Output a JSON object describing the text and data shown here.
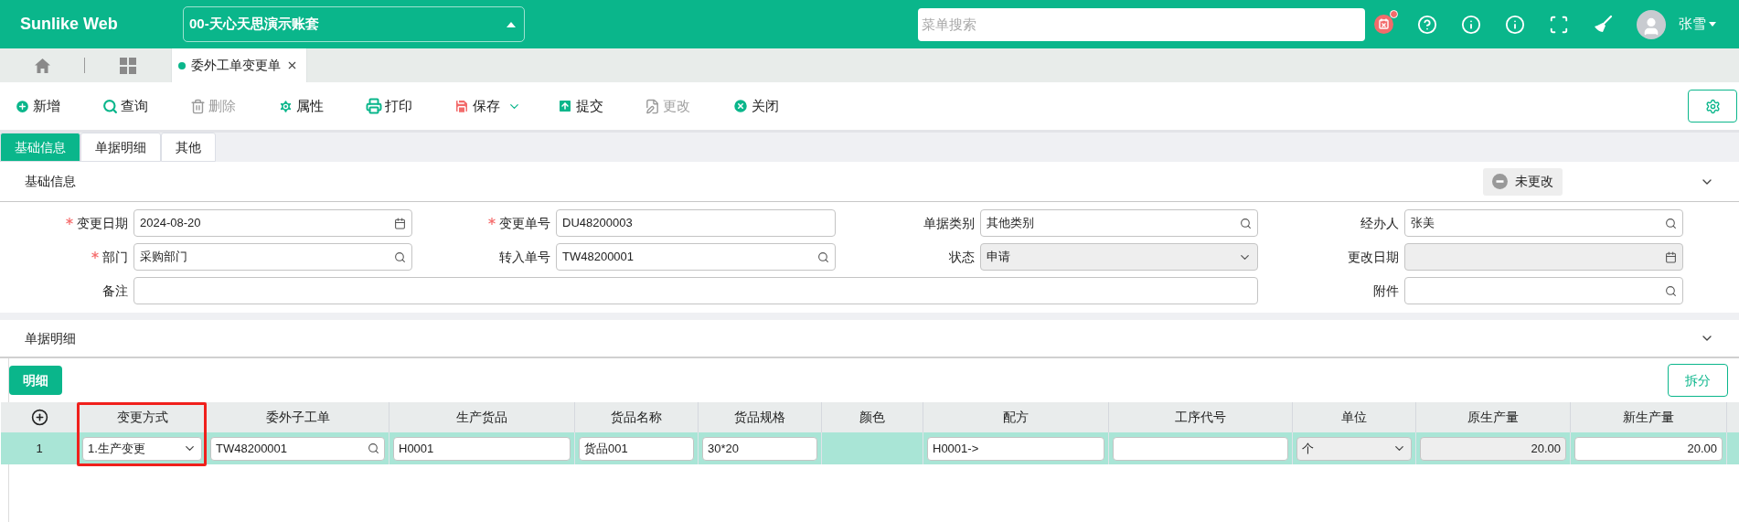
{
  "header": {
    "logo": "Sunlike Web",
    "company": "00-天心天思演示账套",
    "search": {
      "placeholder": "菜单搜索"
    },
    "notification": true,
    "user": "张雪"
  },
  "page_tabs": [
    {
      "label": "委外工单变更单",
      "selected": true
    }
  ],
  "toolbar": [
    {
      "kind": "add",
      "label": "新增",
      "disabled": false
    },
    {
      "kind": "query",
      "label": "查询",
      "disabled": false
    },
    {
      "kind": "delete",
      "label": "删除",
      "disabled": true
    },
    {
      "kind": "props",
      "label": "属性",
      "disabled": false
    },
    {
      "kind": "print",
      "label": "打印",
      "disabled": false
    },
    {
      "kind": "save",
      "label": "保存",
      "disabled": false
    },
    {
      "kind": "submit",
      "label": "提交",
      "disabled": false
    },
    {
      "kind": "modify",
      "label": "更改",
      "disabled": true
    },
    {
      "kind": "close",
      "label": "关闭",
      "disabled": false
    }
  ],
  "sub_tabs": [
    {
      "label": "基础信息",
      "selected": true
    },
    {
      "label": "单据明细",
      "selected": false
    },
    {
      "label": "其他",
      "selected": false
    }
  ],
  "basic_section": {
    "title": "基础信息",
    "status": "未更改",
    "expanded": true
  },
  "fields": [
    {
      "label": "变更日期",
      "required": true,
      "kind": "date",
      "value": "2024-08-20",
      "disabled": false
    },
    {
      "label": "变更单号",
      "required": true,
      "kind": "text",
      "value": "DU48200003",
      "disabled": false
    },
    {
      "label": "单据类别",
      "required": false,
      "kind": "lookup",
      "value": "其他类别",
      "disabled": false
    },
    {
      "label": "经办人",
      "required": false,
      "kind": "lookup",
      "value": "张美",
      "disabled": false
    },
    {
      "label": "部门",
      "required": true,
      "kind": "lookup",
      "value": "采购部门",
      "disabled": false
    },
    {
      "label": "转入单号",
      "required": false,
      "kind": "lookup",
      "value": "TW48200001",
      "disabled": false
    },
    {
      "label": "状态",
      "required": false,
      "kind": "select",
      "value": "申请",
      "disabled": true
    },
    {
      "label": "更改日期",
      "required": false,
      "kind": "date",
      "disabled": true
    },
    {
      "label": "备注",
      "required": false,
      "kind": "wide",
      "disabled": false
    },
    {
      "label": "附件",
      "required": false,
      "kind": "lookup",
      "disabled": false
    }
  ],
  "detail_section": {
    "title": "单据明细",
    "expanded": true,
    "tab": "明细",
    "split_button": "拆分"
  },
  "table": {
    "columns": [
      {
        "kind": "add",
        "highlighted": false
      },
      {
        "label": "变更方式",
        "highlighted": true
      },
      {
        "label": "委外子工单",
        "highlighted": false
      },
      {
        "label": "生产货品",
        "highlighted": false
      },
      {
        "label": "货品名称",
        "highlighted": false
      },
      {
        "label": "货品规格",
        "highlighted": false
      },
      {
        "label": "颜色",
        "highlighted": false
      },
      {
        "label": "配方",
        "highlighted": false
      },
      {
        "label": "工序代号",
        "highlighted": false
      },
      {
        "label": "单位",
        "highlighted": false
      },
      {
        "label": "原生产量",
        "highlighted": false
      },
      {
        "label": "新生产量",
        "highlighted": false
      }
    ],
    "rows": [
      {
        "selected": true,
        "cells": [
          {
            "kind": "index",
            "value": "1"
          },
          {
            "kind": "select",
            "value": "1.生产变更"
          },
          {
            "kind": "lookup",
            "value": "TW48200001"
          },
          {
            "kind": "text",
            "value": "H0001"
          },
          {
            "kind": "text",
            "value": "货品001"
          },
          {
            "kind": "text",
            "value": "30*20"
          },
          {
            "kind": "empty"
          },
          {
            "kind": "text",
            "value": "H0001->"
          },
          {
            "kind": "text"
          },
          {
            "kind": "select-disabled",
            "value": "个"
          },
          {
            "kind": "number-disabled",
            "value": "20.00"
          },
          {
            "kind": "number",
            "value": "20.00"
          }
        ]
      }
    ]
  }
}
